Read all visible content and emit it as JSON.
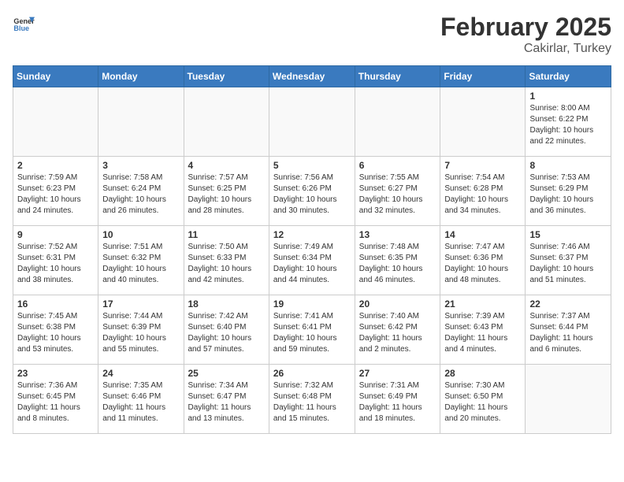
{
  "header": {
    "logo_general": "General",
    "logo_blue": "Blue",
    "month": "February 2025",
    "location": "Cakirlar, Turkey"
  },
  "days_of_week": [
    "Sunday",
    "Monday",
    "Tuesday",
    "Wednesday",
    "Thursday",
    "Friday",
    "Saturday"
  ],
  "weeks": [
    [
      {
        "day": "",
        "info": ""
      },
      {
        "day": "",
        "info": ""
      },
      {
        "day": "",
        "info": ""
      },
      {
        "day": "",
        "info": ""
      },
      {
        "day": "",
        "info": ""
      },
      {
        "day": "",
        "info": ""
      },
      {
        "day": "1",
        "info": "Sunrise: 8:00 AM\nSunset: 6:22 PM\nDaylight: 10 hours and 22 minutes."
      }
    ],
    [
      {
        "day": "2",
        "info": "Sunrise: 7:59 AM\nSunset: 6:23 PM\nDaylight: 10 hours and 24 minutes."
      },
      {
        "day": "3",
        "info": "Sunrise: 7:58 AM\nSunset: 6:24 PM\nDaylight: 10 hours and 26 minutes."
      },
      {
        "day": "4",
        "info": "Sunrise: 7:57 AM\nSunset: 6:25 PM\nDaylight: 10 hours and 28 minutes."
      },
      {
        "day": "5",
        "info": "Sunrise: 7:56 AM\nSunset: 6:26 PM\nDaylight: 10 hours and 30 minutes."
      },
      {
        "day": "6",
        "info": "Sunrise: 7:55 AM\nSunset: 6:27 PM\nDaylight: 10 hours and 32 minutes."
      },
      {
        "day": "7",
        "info": "Sunrise: 7:54 AM\nSunset: 6:28 PM\nDaylight: 10 hours and 34 minutes."
      },
      {
        "day": "8",
        "info": "Sunrise: 7:53 AM\nSunset: 6:29 PM\nDaylight: 10 hours and 36 minutes."
      }
    ],
    [
      {
        "day": "9",
        "info": "Sunrise: 7:52 AM\nSunset: 6:31 PM\nDaylight: 10 hours and 38 minutes."
      },
      {
        "day": "10",
        "info": "Sunrise: 7:51 AM\nSunset: 6:32 PM\nDaylight: 10 hours and 40 minutes."
      },
      {
        "day": "11",
        "info": "Sunrise: 7:50 AM\nSunset: 6:33 PM\nDaylight: 10 hours and 42 minutes."
      },
      {
        "day": "12",
        "info": "Sunrise: 7:49 AM\nSunset: 6:34 PM\nDaylight: 10 hours and 44 minutes."
      },
      {
        "day": "13",
        "info": "Sunrise: 7:48 AM\nSunset: 6:35 PM\nDaylight: 10 hours and 46 minutes."
      },
      {
        "day": "14",
        "info": "Sunrise: 7:47 AM\nSunset: 6:36 PM\nDaylight: 10 hours and 48 minutes."
      },
      {
        "day": "15",
        "info": "Sunrise: 7:46 AM\nSunset: 6:37 PM\nDaylight: 10 hours and 51 minutes."
      }
    ],
    [
      {
        "day": "16",
        "info": "Sunrise: 7:45 AM\nSunset: 6:38 PM\nDaylight: 10 hours and 53 minutes."
      },
      {
        "day": "17",
        "info": "Sunrise: 7:44 AM\nSunset: 6:39 PM\nDaylight: 10 hours and 55 minutes."
      },
      {
        "day": "18",
        "info": "Sunrise: 7:42 AM\nSunset: 6:40 PM\nDaylight: 10 hours and 57 minutes."
      },
      {
        "day": "19",
        "info": "Sunrise: 7:41 AM\nSunset: 6:41 PM\nDaylight: 10 hours and 59 minutes."
      },
      {
        "day": "20",
        "info": "Sunrise: 7:40 AM\nSunset: 6:42 PM\nDaylight: 11 hours and 2 minutes."
      },
      {
        "day": "21",
        "info": "Sunrise: 7:39 AM\nSunset: 6:43 PM\nDaylight: 11 hours and 4 minutes."
      },
      {
        "day": "22",
        "info": "Sunrise: 7:37 AM\nSunset: 6:44 PM\nDaylight: 11 hours and 6 minutes."
      }
    ],
    [
      {
        "day": "23",
        "info": "Sunrise: 7:36 AM\nSunset: 6:45 PM\nDaylight: 11 hours and 8 minutes."
      },
      {
        "day": "24",
        "info": "Sunrise: 7:35 AM\nSunset: 6:46 PM\nDaylight: 11 hours and 11 minutes."
      },
      {
        "day": "25",
        "info": "Sunrise: 7:34 AM\nSunset: 6:47 PM\nDaylight: 11 hours and 13 minutes."
      },
      {
        "day": "26",
        "info": "Sunrise: 7:32 AM\nSunset: 6:48 PM\nDaylight: 11 hours and 15 minutes."
      },
      {
        "day": "27",
        "info": "Sunrise: 7:31 AM\nSunset: 6:49 PM\nDaylight: 11 hours and 18 minutes."
      },
      {
        "day": "28",
        "info": "Sunrise: 7:30 AM\nSunset: 6:50 PM\nDaylight: 11 hours and 20 minutes."
      },
      {
        "day": "",
        "info": ""
      }
    ]
  ]
}
